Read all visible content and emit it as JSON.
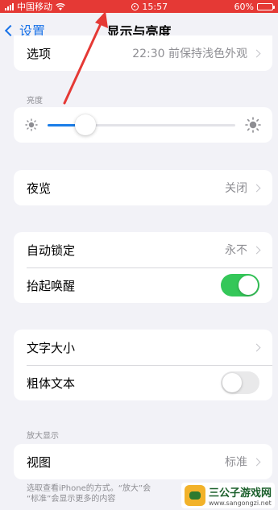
{
  "status_bar": {
    "carrier": "中国移动",
    "time": "15:57",
    "battery": "60%",
    "battery_level": 0.6
  },
  "nav": {
    "back_label": "设置",
    "title": "显示与亮度"
  },
  "appearance_row": {
    "label": "选项",
    "value": "22:30 前保持浅色外观"
  },
  "brightness": {
    "header": "亮度",
    "level": 0.2
  },
  "night_shift": {
    "label": "夜览",
    "value": "关闭"
  },
  "auto_lock": {
    "label": "自动锁定",
    "value": "永不"
  },
  "raise_to_wake": {
    "label": "抬起唤醒",
    "enabled": true
  },
  "text_size": {
    "label": "文字大小"
  },
  "bold_text": {
    "label": "粗体文本",
    "enabled": false
  },
  "display_zoom": {
    "header": "放大显示",
    "label": "视图",
    "value": "标准",
    "footer": "选取查看iPhone的方式。“放大”会\n“标准”会显示更多的内容"
  },
  "watermark": {
    "title": "三公子游戏网",
    "url": "www.sangongzi.net"
  },
  "colors": {
    "accent": "#1a73e8",
    "toggle_on": "#34c759",
    "status_bar": "#e53935",
    "arrow": "#e53935"
  }
}
